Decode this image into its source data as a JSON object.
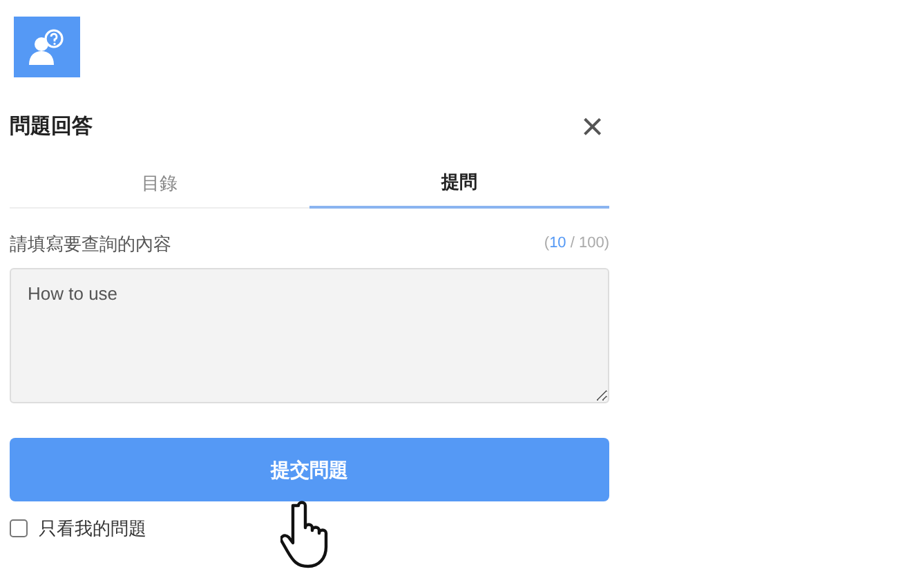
{
  "panel": {
    "title": "問題回答",
    "close": "×"
  },
  "tabs": [
    {
      "label": "目錄",
      "selected": false
    },
    {
      "label": "提問",
      "selected": true
    }
  ],
  "form": {
    "label": "請填寫要查詢的內容",
    "counter": {
      "prefix": "(",
      "current": "10",
      "rest": " / 100)"
    },
    "value": "How to use",
    "submit": "提交問題",
    "filter": {
      "label": "只看我的問題",
      "checked": false
    }
  }
}
